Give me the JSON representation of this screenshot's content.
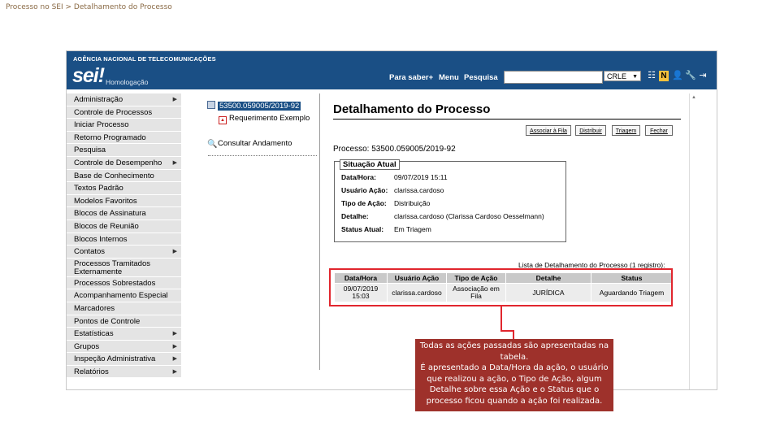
{
  "breadcrumb": "Processo no SEI > Detalhamento do Processo",
  "header": {
    "agency": "AGÊNCIA NACIONAL DE TELECOMUNICAÇÕES",
    "logo": "sei!",
    "environment": "Homologação",
    "links": [
      "Para saber+",
      "Menu",
      "Pesquisa"
    ],
    "search_value": "",
    "unit_selected": "CRLE",
    "icons": [
      "menu-icon",
      "notes-icon",
      "user-icon",
      "tools-icon",
      "exit-icon"
    ]
  },
  "sidebar": {
    "items": [
      {
        "label": "Administração",
        "submenu": true
      },
      {
        "label": "Controle de Processos",
        "submenu": false
      },
      {
        "label": "Iniciar Processo",
        "submenu": false
      },
      {
        "label": "Retorno Programado",
        "submenu": false
      },
      {
        "label": "Pesquisa",
        "submenu": false
      },
      {
        "label": "Controle de Desempenho",
        "submenu": true
      },
      {
        "label": "Base de Conhecimento",
        "submenu": false
      },
      {
        "label": "Textos Padrão",
        "submenu": false
      },
      {
        "label": "Modelos Favoritos",
        "submenu": false
      },
      {
        "label": "Blocos de Assinatura",
        "submenu": false
      },
      {
        "label": "Blocos de Reunião",
        "submenu": false
      },
      {
        "label": "Blocos Internos",
        "submenu": false
      },
      {
        "label": "Contatos",
        "submenu": true
      },
      {
        "label": "Processos Tramitados Externamente",
        "submenu": false
      },
      {
        "label": "Processos Sobrestados",
        "submenu": false
      },
      {
        "label": "Acompanhamento Especial",
        "submenu": false
      },
      {
        "label": "Marcadores",
        "submenu": false
      },
      {
        "label": "Pontos de Controle",
        "submenu": false
      },
      {
        "label": "Estatísticas",
        "submenu": true
      },
      {
        "label": "Grupos",
        "submenu": true
      },
      {
        "label": "Inspeção Administrativa",
        "submenu": true
      },
      {
        "label": "Relatórios",
        "submenu": true
      }
    ]
  },
  "tree": {
    "process_number": "53500.059005/2019-92",
    "document": "Requerimento Exemplo",
    "consult_link": "Consultar Andamento"
  },
  "main": {
    "title": "Detalhamento do Processo",
    "buttons": [
      "Associar à Fila",
      "Distribuir",
      "Triagem",
      "Fechar"
    ],
    "process_label": "Processo:",
    "process_number": "53500.059005/2019-92",
    "situacao": {
      "legend": "Situação Atual",
      "fields": [
        {
          "label": "Data/Hora:",
          "value": "09/07/2019 15:11"
        },
        {
          "label": "Usuário Ação:",
          "value": "clarissa.cardoso"
        },
        {
          "label": "Tipo de Ação:",
          "value": "Distribuição"
        },
        {
          "label": "Detalhe:",
          "value": "clarissa.cardoso (Clarissa Cardoso Oesselmann)"
        },
        {
          "label": "Status Atual:",
          "value": "Em Triagem"
        }
      ]
    },
    "list_caption": "Lista de Detalhamento do Processo (1 registro):",
    "table": {
      "headers": [
        "Data/Hora",
        "Usuário Ação",
        "Tipo de Ação",
        "Detalhe",
        "Status"
      ],
      "rows": [
        [
          "09/07/2019 15:03",
          "clarissa.cardoso",
          "Associação em Fila",
          "JURÍDICA",
          "Aguardando Triagem"
        ]
      ]
    }
  },
  "callout": {
    "text": "Todas as ações passadas são apresentadas na tabela.\nÉ apresentado a Data/Hora da ação, o usuário que realizou a ação, o Tipo de Ação, algum Detalhe sobre essa Ação e o Status que o processo ficou quando a ação foi realizada."
  },
  "colors": {
    "header_blue": "#1a4f85",
    "highlight_red": "#e1262e",
    "callout_bg": "#9e312b"
  }
}
